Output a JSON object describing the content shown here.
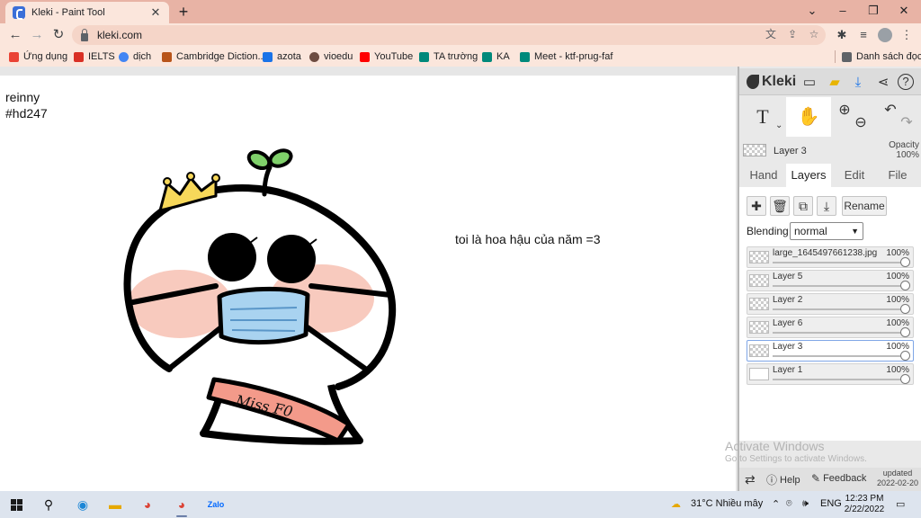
{
  "browser": {
    "tab_title": "Kleki - Paint Tool",
    "tab_close": "✕",
    "new_tab": "+",
    "url": "kleki.com",
    "window_controls": {
      "minimize": "⌄",
      "restore": "–",
      "maximize": "❐",
      "close": "✕"
    }
  },
  "bookmarks": [
    {
      "label": "Ứng dụng",
      "icon": "apps-grid-icon",
      "color": "#ea4335"
    },
    {
      "label": "IELTS",
      "icon": "ielts-icon",
      "color": "#d93025"
    },
    {
      "label": "dịch",
      "icon": "google-icon",
      "color": "#4285f4"
    },
    {
      "label": "Cambridge Diction...",
      "icon": "cambridge-icon",
      "color": "#b8541a"
    },
    {
      "label": "azota",
      "icon": "azota-icon",
      "color": "#1a73e8"
    },
    {
      "label": "vioedu",
      "icon": "vioedu-icon",
      "color": "#6d4c41"
    },
    {
      "label": "YouTube",
      "icon": "youtube-icon",
      "color": "#ff0000"
    },
    {
      "label": "TA trường",
      "icon": "meet-icon",
      "color": "#00897b"
    },
    {
      "label": "KA",
      "icon": "meet-icon",
      "color": "#00897b"
    },
    {
      "label": "Meet - ktf-prug-faf",
      "icon": "meet-icon",
      "color": "#00897b"
    }
  ],
  "reading_list": "Danh sách đọc",
  "canvas": {
    "line1": "reinny",
    "line2": "#hd247",
    "caption": "toi là hoa hậu của năm =3",
    "sash_text": "Miss F0"
  },
  "kleki": {
    "logo": "Kleki",
    "active_layer": {
      "name": "Layer 3",
      "opacity_label": "Opacity",
      "opacity_value": "100%"
    },
    "tabs": {
      "hand": "Hand",
      "layers": "Layers",
      "edit": "Edit",
      "file": "File"
    },
    "rename": "Rename",
    "blending_label": "Blending",
    "blending_value": "normal",
    "layers": [
      {
        "name": "large_1645497661238.jpg",
        "opacity": "100%",
        "active": false
      },
      {
        "name": "Layer 5",
        "opacity": "100%",
        "active": false
      },
      {
        "name": "Layer 2",
        "opacity": "100%",
        "active": false
      },
      {
        "name": "Layer 6",
        "opacity": "100%",
        "active": false
      },
      {
        "name": "Layer 3",
        "opacity": "100%",
        "active": true
      },
      {
        "name": "Layer 1",
        "opacity": "100%",
        "active": false
      }
    ],
    "activate_title": "Activate Windows",
    "activate_sub": "Go to Settings to activate Windows.",
    "footer": {
      "help": "Help",
      "feedback": "Feedback",
      "updated_label": "updated",
      "updated_date": "2022-02-20"
    }
  },
  "taskbar": {
    "weather": "31°C  Nhiều mây",
    "language": "ENG",
    "time": "12:23 PM",
    "date": "2/22/2022"
  },
  "colors": {
    "tabstrip": "#e8b3a5",
    "toolbar": "#fbe6dc",
    "blush": "#f6b8a8",
    "mask": "#a9d3f0",
    "crown": "#f7d85a",
    "sprout": "#7fd06a",
    "sash": "#f39a8a"
  }
}
